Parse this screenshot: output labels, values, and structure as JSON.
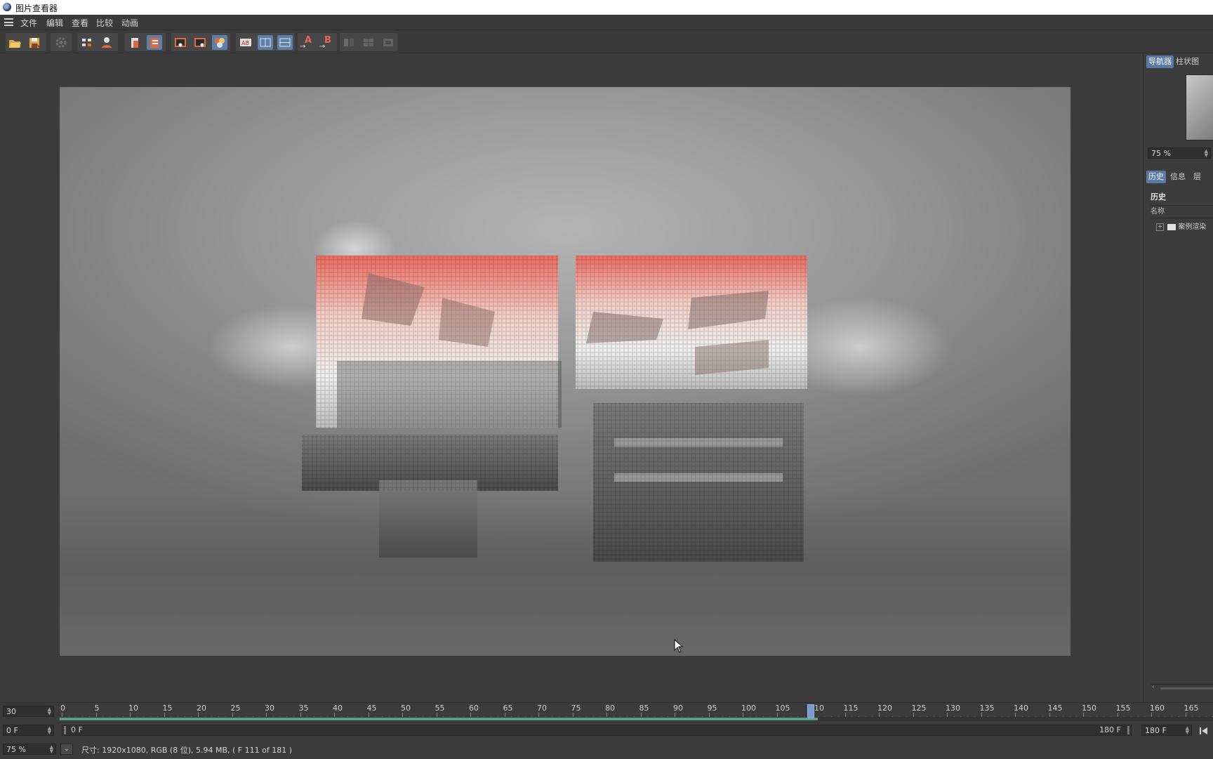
{
  "window": {
    "title": "图片查看器"
  },
  "menu": {
    "items": [
      "文件",
      "编辑",
      "查看",
      "比较",
      "动画"
    ]
  },
  "toolbar": {
    "buttons": [
      {
        "name": "open-icon",
        "active": false
      },
      {
        "name": "save-icon",
        "active": false
      },
      {
        "name": "settings-icon",
        "active": false
      },
      {
        "name": "filter-icon",
        "active": false
      },
      {
        "name": "user-icon",
        "active": false
      },
      {
        "name": "channel-icon",
        "active": false
      },
      {
        "name": "layers-icon",
        "active": true
      },
      {
        "name": "view-single-icon",
        "active": false
      },
      {
        "name": "view-region-icon",
        "active": false
      },
      {
        "name": "view-compare-icon",
        "active": false
      },
      {
        "name": "ab-icon",
        "active": false
      },
      {
        "name": "split-vertical-icon",
        "active": true
      },
      {
        "name": "split-horizontal-icon",
        "active": true
      },
      {
        "name": "set-a-icon",
        "active": false
      },
      {
        "name": "set-b-icon",
        "active": false
      }
    ],
    "set_a_label": "A",
    "set_b_label": "B"
  },
  "right_panel": {
    "top_tabs": [
      "导航器",
      "柱状图"
    ],
    "zoom": "75 %",
    "bottom_tabs": [
      "历史",
      "信息",
      "层"
    ],
    "history_title": "历史",
    "column_name": "名称",
    "history_items": [
      "案例渲染"
    ]
  },
  "timeline": {
    "fps": "30",
    "ticks": [
      0,
      5,
      10,
      15,
      20,
      25,
      30,
      35,
      40,
      45,
      50,
      55,
      60,
      65,
      70,
      75,
      80,
      85,
      90,
      95,
      100,
      105,
      110,
      115,
      120,
      125,
      130,
      135,
      140,
      145,
      150,
      155,
      160,
      165
    ],
    "current_frame": 110,
    "cached_end_frame": 111,
    "start_field": "0 F",
    "range_start": "0 F",
    "range_end": "180 F",
    "end_field": "180 F"
  },
  "status": {
    "zoom": "75 %",
    "info": "尺寸: 1920x1080, RGB (8 位), 5.94 MB,  ( F 111 of 181 )"
  },
  "colors": {
    "panel_bg": "#3c3c3c",
    "accent": "#5a7aa6",
    "cache_bar": "#5f9e86",
    "text_red": "#e8665c"
  }
}
